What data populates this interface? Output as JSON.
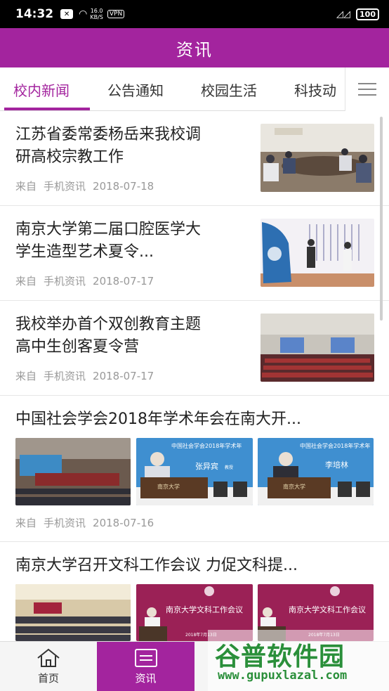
{
  "status_bar": {
    "time": "14:32",
    "net_speed_value": "16.0",
    "net_speed_unit": "KB/S",
    "vpn": "VPN",
    "battery": "100"
  },
  "header": {
    "title": "资讯"
  },
  "tabs": [
    {
      "label": "校内新闻",
      "active": true
    },
    {
      "label": "公告通知",
      "active": false
    },
    {
      "label": "校园生活",
      "active": false
    },
    {
      "label": "科技动",
      "active": false
    }
  ],
  "news": [
    {
      "title_line1": "江苏省委常委杨岳来我校调",
      "title_line2": "研高校宗教工作",
      "source": "来自",
      "channel": "手机资讯",
      "date": "2018-07-18"
    },
    {
      "title_line1": "南京大学第二届口腔医学大",
      "title_line2": "学生造型艺术夏令...",
      "source": "来自",
      "channel": "手机资讯",
      "date": "2018-07-17"
    },
    {
      "title_line1": "我校举办首个双创教育主题",
      "title_line2": "高中生创客夏令营",
      "source": "来自",
      "channel": "手机资讯",
      "date": "2018-07-17"
    },
    {
      "title": "中国社会学会2018年学术年会在南大开...",
      "source": "来自",
      "channel": "手机资讯",
      "date": "2018-07-16",
      "img_text": {
        "banner": "中国社会学会2018年学术年",
        "name1": "张异宾",
        "name2": "李培林",
        "role": "教授",
        "podium": "南京大学"
      }
    },
    {
      "title": "南京大学召开文科工作会议 力促文科提...",
      "img_text": {
        "banner": "南京大学文科工作会议",
        "date": "2018年7月13日"
      }
    }
  ],
  "bottom_nav": [
    {
      "label": "首页",
      "icon": "home-icon",
      "active": false
    },
    {
      "label": "资讯",
      "icon": "news-icon",
      "active": true
    }
  ],
  "watermark": {
    "text": "谷普软件园",
    "url": "www.gupuxlazal.com"
  },
  "colors": {
    "primary": "#a3249e",
    "text": "#222222",
    "meta": "#999999"
  }
}
